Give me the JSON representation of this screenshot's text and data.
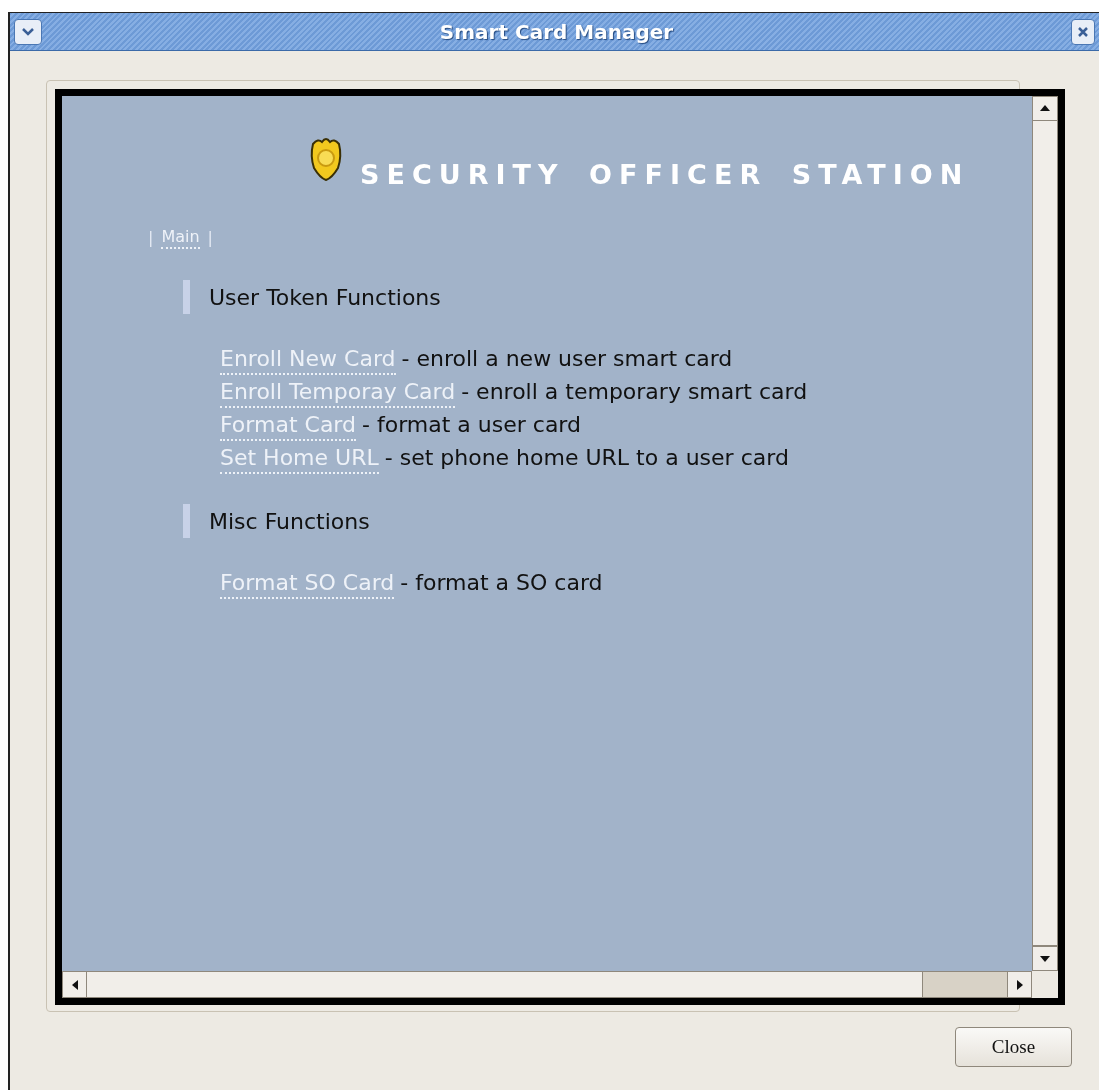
{
  "window": {
    "title": "Smart Card Manager"
  },
  "heading": "SECURITY OFFICER STATION",
  "nav_separator": "|",
  "nav": [
    {
      "label": "Main"
    }
  ],
  "sections": [
    {
      "title": "User Token Functions",
      "items": [
        {
          "link": "Enroll New Card",
          "description": "- enroll a new user smart card"
        },
        {
          "link": "Enroll Temporay Card",
          "description": "- enroll a temporary smart card"
        },
        {
          "link": "Format Card",
          "description": "- format a user card"
        },
        {
          "link": "Set Home URL",
          "description": "- set phone home URL to a user card"
        }
      ]
    },
    {
      "title": "Misc Functions",
      "items": [
        {
          "link": "Format SO Card",
          "description": "- format a SO card"
        }
      ]
    }
  ],
  "buttons": [
    {
      "label": "Close"
    }
  ]
}
